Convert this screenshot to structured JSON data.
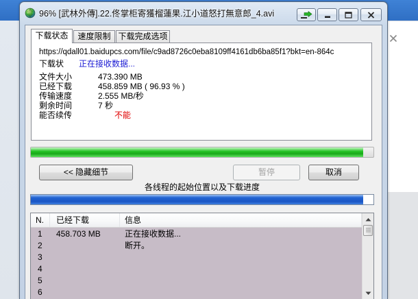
{
  "window": {
    "title": "96% [武林外傳].22.佟掌柜寄獲榴蓮果.江小道怒打無意郎_4.avi",
    "app_icon": "idm-globe-icon",
    "controls": {
      "tray_icon": "send-to-tray-icon",
      "minimize_icon": "minimize-icon",
      "maximize_icon": "maximize-icon",
      "close_icon": "close-icon"
    }
  },
  "tabs": [
    {
      "label": "下载状态"
    },
    {
      "label": "速度限制"
    },
    {
      "label": "下载完成选项"
    }
  ],
  "status": {
    "url": "https://qdall01.baidupcs.com/file/c9ad8726c0eba8109ff4161db6ba85f1?bkt=en-864c",
    "state_label": "下载状",
    "state_value": "正在接收数据...",
    "details": [
      {
        "label": "文件大小",
        "value": "473.390 MB"
      },
      {
        "label": "已经下载",
        "value": "458.859 MB ( 96.93 % )"
      },
      {
        "label": "传输速度",
        "value": "2.555 MB/秒"
      },
      {
        "label": "剩余时间",
        "value": "7 秒"
      },
      {
        "label": "能否续传",
        "value": "不能"
      }
    ]
  },
  "progress": {
    "percent": 96.93
  },
  "buttons": {
    "hide_details": "<< 隐藏细节",
    "pause": "暂停",
    "pause_disabled": true,
    "cancel": "取消"
  },
  "threads": {
    "label": "各线程的起始位置以及下载进度",
    "progress_percent": 97,
    "columns": [
      "N.",
      "已经下载",
      "信息"
    ],
    "rows": [
      {
        "n": "1",
        "downloaded": "458.703 MB",
        "info": "正在接收数据..."
      },
      {
        "n": "2",
        "downloaded": "",
        "info": "断开。"
      },
      {
        "n": "3",
        "downloaded": "",
        "info": ""
      },
      {
        "n": "4",
        "downloaded": "",
        "info": ""
      },
      {
        "n": "5",
        "downloaded": "",
        "info": ""
      },
      {
        "n": "6",
        "downloaded": "",
        "info": ""
      }
    ],
    "scroll_up_icon": "scroll-up-arrow-icon",
    "scroll_down_icon": "scroll-down-arrow-icon"
  },
  "background": {
    "dialog_close_icon": "close-icon"
  },
  "colors": {
    "progress_green": "#25c425",
    "thread_blue": "#2264d2",
    "status_blue": "#1c1cd4",
    "warning_red": "#e00000",
    "list_bg": "#c7bcc7"
  }
}
